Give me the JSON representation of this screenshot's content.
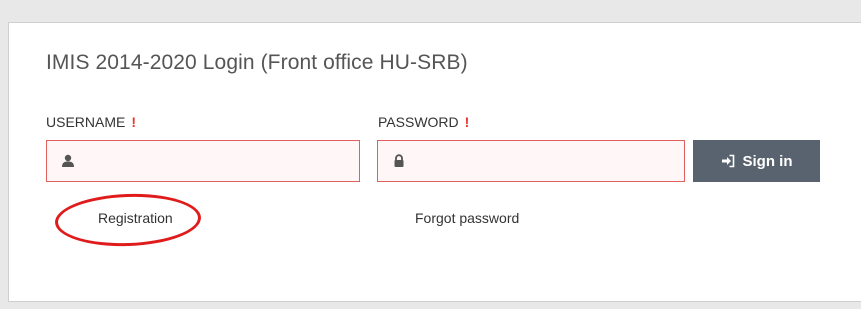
{
  "login": {
    "title": "IMIS 2014-2020 Login (Front office HU-SRB)",
    "username_label": "USERNAME",
    "password_label": "PASSWORD",
    "required_mark": "!",
    "username_value": "",
    "password_value": "",
    "signin_label": "Sign in",
    "registration_label": "Registration",
    "forgot_label": "Forgot password"
  },
  "icons": {
    "username": "user-icon",
    "password": "lock-icon",
    "signin": "sign-in-icon"
  },
  "colors": {
    "error_border": "#e06060",
    "required_mark": "#e8352b",
    "button_bg": "#58636f",
    "annotation_circle": "#e01b1b"
  }
}
